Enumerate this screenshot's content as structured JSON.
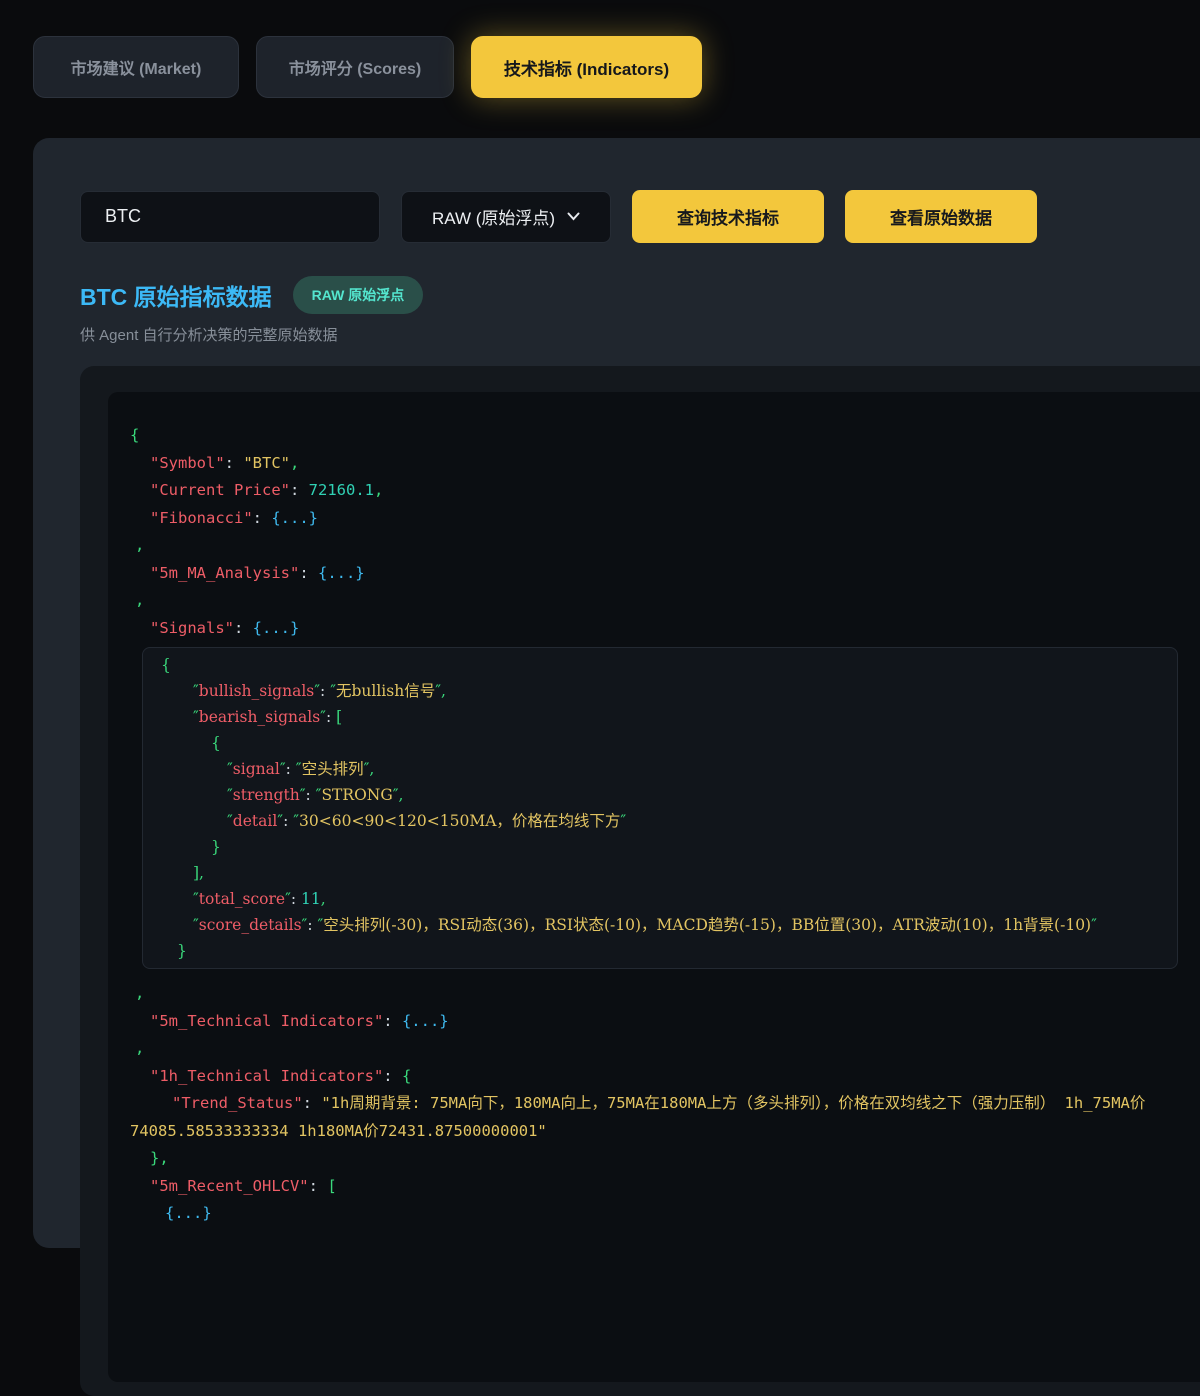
{
  "tabs": [
    {
      "label": "市场建议 (Market)",
      "active": false
    },
    {
      "label": "市场评分 (Scores)",
      "active": false
    },
    {
      "label": "技术指标 (Indicators)",
      "active": true
    }
  ],
  "query_bar": {
    "symbol_input_value": "BTC",
    "mode_select_value": "RAW (原始浮点)",
    "query_button_label": "查询技术指标",
    "view_raw_button_label": "查看原始数据"
  },
  "result_header": {
    "title": "BTC 原始指标数据",
    "badge": "RAW 原始浮点",
    "subtitle": "供 Agent 自行分析决策的完整原始数据"
  },
  "colors": {
    "accent_yellow": "#f3c73c",
    "title_cyan": "#3cb9f6",
    "badge_teal_bg": "#2a4f49",
    "badge_teal_text": "#54e6cf",
    "code_key_red": "#ee5d67",
    "code_string_yellow": "#e2c462",
    "code_number_teal": "#30d1b4",
    "code_punct_green": "#3ad97c",
    "code_collapsed_cyan": "#3fb9ee"
  },
  "code": {
    "main_top": [
      {
        "i": 0,
        "t": [
          [
            "p",
            "{"
          ]
        ]
      },
      {
        "i": 20,
        "t": [
          [
            "k",
            "\"Symbol\""
          ],
          [
            "c",
            ": "
          ],
          [
            "s",
            "\"BTC\""
          ],
          [
            "p",
            ","
          ]
        ]
      },
      {
        "i": 20,
        "t": [
          [
            "k",
            "\"Current Price\""
          ],
          [
            "c",
            ": "
          ],
          [
            "n",
            "72160.1"
          ],
          [
            "p",
            ","
          ]
        ]
      },
      {
        "i": 20,
        "t": [
          [
            "k",
            "\"Fibonacci\""
          ],
          [
            "c",
            ": "
          ],
          [
            "e",
            "{...}"
          ]
        ]
      },
      {
        "i": 5,
        "t": [
          [
            "p",
            ","
          ]
        ]
      },
      {
        "i": 20,
        "t": [
          [
            "k",
            "\"5m_MA_Analysis\""
          ],
          [
            "c",
            ": "
          ],
          [
            "e",
            "{...}"
          ]
        ]
      },
      {
        "i": 5,
        "t": [
          [
            "p",
            ","
          ]
        ]
      },
      {
        "i": 20,
        "t": [
          [
            "k",
            "\"Signals\""
          ],
          [
            "c",
            ": "
          ],
          [
            "e",
            "{...}"
          ]
        ]
      }
    ],
    "signals_block": [
      {
        "i": 2,
        "t": [
          [
            "p",
            "{"
          ]
        ]
      },
      {
        "i": 34,
        "t": [
          [
            "q",
            "″"
          ],
          [
            "k",
            "bullish_signals"
          ],
          [
            "q",
            "″"
          ],
          [
            "c",
            ": "
          ],
          [
            "q",
            "″"
          ],
          [
            "s",
            "无bullish信号"
          ],
          [
            "q",
            "″"
          ],
          [
            "p",
            ","
          ]
        ]
      },
      {
        "i": 34,
        "t": [
          [
            "q",
            "″"
          ],
          [
            "k",
            "bearish_signals"
          ],
          [
            "q",
            "″"
          ],
          [
            "c",
            ": "
          ],
          [
            "p",
            "["
          ]
        ]
      },
      {
        "i": 52,
        "t": [
          [
            "p",
            "{"
          ]
        ]
      },
      {
        "i": 68,
        "t": [
          [
            "q",
            "″"
          ],
          [
            "k",
            "signal"
          ],
          [
            "q",
            "″"
          ],
          [
            "c",
            ": "
          ],
          [
            "q",
            "″"
          ],
          [
            "s",
            "空头排列"
          ],
          [
            "q",
            "″"
          ],
          [
            "p",
            ","
          ]
        ]
      },
      {
        "i": 68,
        "t": [
          [
            "q",
            "″"
          ],
          [
            "k",
            "strength"
          ],
          [
            "q",
            "″"
          ],
          [
            "c",
            ": "
          ],
          [
            "q",
            "″"
          ],
          [
            "s",
            "STRONG"
          ],
          [
            "q",
            "″"
          ],
          [
            "p",
            ","
          ]
        ]
      },
      {
        "i": 68,
        "t": [
          [
            "q",
            "″"
          ],
          [
            "k",
            "detail"
          ],
          [
            "q",
            "″"
          ],
          [
            "c",
            ": "
          ],
          [
            "q",
            "″"
          ],
          [
            "s",
            "30<60<90<120<150MA，价格在均线下方"
          ],
          [
            "q",
            "″"
          ]
        ]
      },
      {
        "i": 52,
        "t": [
          [
            "p",
            "}"
          ]
        ]
      },
      {
        "i": 34,
        "t": [
          [
            "p",
            "],"
          ]
        ]
      },
      {
        "i": 34,
        "t": [
          [
            "q",
            "″"
          ],
          [
            "k",
            "total_score"
          ],
          [
            "q",
            "″"
          ],
          [
            "c",
            ": "
          ],
          [
            "n",
            "11"
          ],
          [
            "p",
            ","
          ]
        ]
      },
      {
        "i": 34,
        "t": [
          [
            "q",
            "″"
          ],
          [
            "k",
            "score_details"
          ],
          [
            "q",
            "″"
          ],
          [
            "c",
            ": "
          ],
          [
            "q",
            "″"
          ],
          [
            "s",
            "空头排列(-30)，RSI动态(36)，RSI状态(-10)，MACD趋势(-15)，BB位置(30)，ATR波动(10)，1h背景(-10)"
          ],
          [
            "q",
            "″"
          ]
        ]
      },
      {
        "i": 18,
        "t": [
          [
            "p",
            "}"
          ]
        ]
      }
    ],
    "main_bottom": [
      {
        "i": 5,
        "t": [
          [
            "p",
            ","
          ]
        ]
      },
      {
        "i": 20,
        "t": [
          [
            "k",
            "\"5m_Technical Indicators\""
          ],
          [
            "c",
            ": "
          ],
          [
            "e",
            "{...}"
          ]
        ]
      },
      {
        "i": 5,
        "t": [
          [
            "p",
            ","
          ]
        ]
      },
      {
        "i": 20,
        "t": [
          [
            "k",
            "\"1h_Technical Indicators\""
          ],
          [
            "c",
            ": "
          ],
          [
            "p",
            "{"
          ]
        ]
      },
      {
        "i": 42,
        "t": [
          [
            "k",
            "\"Trend_Status\""
          ],
          [
            "c",
            ": "
          ],
          [
            "s",
            "\"1h周期背景: 75MA向下，180MA向上，75MA在180MA上方（多头排列），价格在双均线之下（强力压制） 1h_75MA价74085.58533333334 1h180MA价72431.87500000001\""
          ]
        ]
      },
      {
        "i": 20,
        "t": [
          [
            "p",
            "},"
          ]
        ]
      },
      {
        "i": 20,
        "t": [
          [
            "k",
            "\"5m_Recent_OHLCV\""
          ],
          [
            "c",
            ": "
          ],
          [
            "p",
            "["
          ]
        ]
      },
      {
        "i": 35,
        "t": [
          [
            "e",
            "{...}"
          ]
        ]
      }
    ]
  }
}
